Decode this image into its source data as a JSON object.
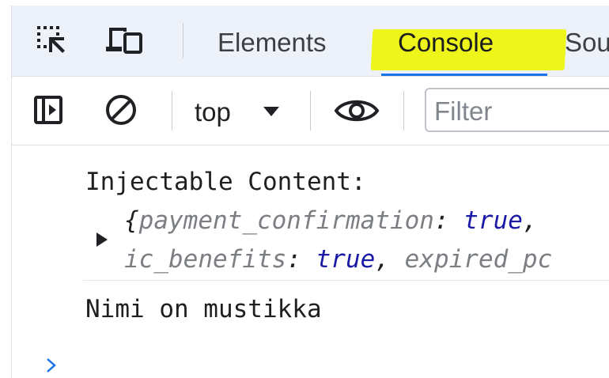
{
  "tabs": {
    "elements": "Elements",
    "console": "Console",
    "sources_partial": "Sou"
  },
  "toolbar": {
    "context": "top",
    "filter_placeholder": "Filter"
  },
  "console": {
    "log1_text": "Injectable Content:",
    "object_preview": {
      "open_brace": "{",
      "key1": "payment_confirmation",
      "colon1": ": ",
      "val1": "true",
      "comma1": ",",
      "key2": "ic_benefits",
      "colon2": ": ",
      "val2": "true",
      "comma2": ", ",
      "key3_partial": "expired_pc"
    },
    "log2_text": "Nimi on mustikka"
  },
  "colors": {
    "tabbar_bg": "#edf2fa",
    "highlight": "#eef51a",
    "accent": "#1a73e8",
    "boolean": "#1a1aa6"
  },
  "icons": [
    "inspect-element-icon",
    "device-toolbar-icon",
    "sidebar-toggle-icon",
    "clear-console-icon",
    "dropdown-caret-icon",
    "live-expression-eye-icon",
    "expand-triangle-icon",
    "console-prompt-icon"
  ]
}
